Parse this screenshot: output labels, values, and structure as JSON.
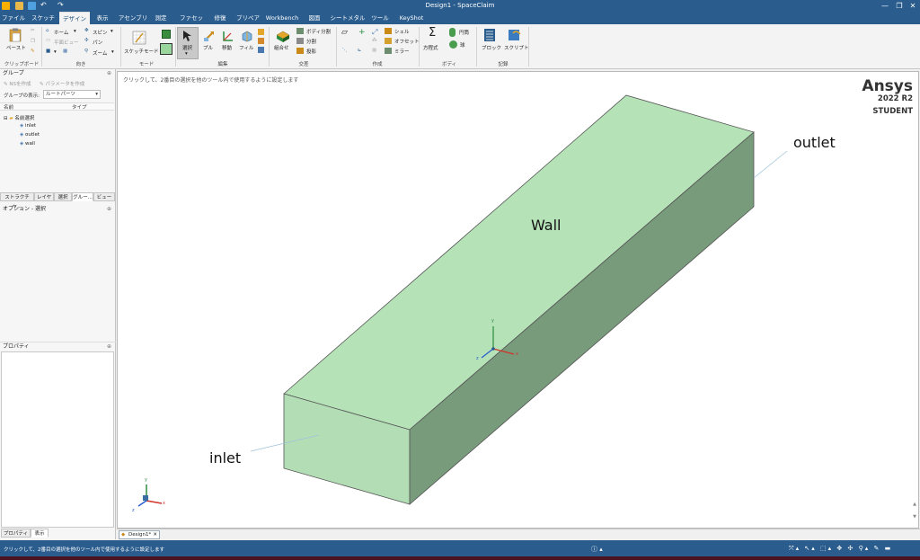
{
  "window": {
    "title": "Design1 - SpaceClaim",
    "controls": {
      "minimize": "—",
      "restore": "❐",
      "close": "✕"
    }
  },
  "tabs": [
    {
      "label": "ファイル"
    },
    {
      "label": "スケッチ"
    },
    {
      "label": "デザイン"
    },
    {
      "label": "表示"
    },
    {
      "label": "アセンブリ"
    },
    {
      "label": "測定"
    },
    {
      "label": "ファセット"
    },
    {
      "label": "修復"
    },
    {
      "label": "プリペア"
    },
    {
      "label": "Workbench"
    },
    {
      "label": "図面"
    },
    {
      "label": "シートメタル"
    },
    {
      "label": "ツール"
    },
    {
      "label": "KeyShot"
    }
  ],
  "active_tab": "デザイン",
  "ribbon": {
    "clipboard": {
      "paste": "ペースト",
      "group": "クリップボード"
    },
    "orient": {
      "home": "ホーム",
      "plane_view": "平面ビュー",
      "spin": "スピン",
      "pan": "パン",
      "zoom": "ズーム",
      "group": "向き"
    },
    "mode": {
      "sketch_mode": "スケッチモード",
      "group": "モード"
    },
    "edit": {
      "select": "選択",
      "pull": "プル",
      "move": "移動",
      "fill": "フィル",
      "group": "編集"
    },
    "intersect": {
      "combine": "組合せ",
      "split_body": "ボディ分割",
      "split": "分割",
      "project": "投影",
      "group": "交差"
    },
    "create": {
      "shell": "シェル",
      "offset": "オフセット",
      "mirror": "ミラー",
      "group": "作成"
    },
    "body": {
      "equation": "方程式",
      "cylinder": "円筒",
      "sphere": "球",
      "group": "ボディ"
    },
    "record": {
      "block": "ブロック",
      "script": "スクリプト",
      "group": "記録"
    }
  },
  "groups_panel": {
    "title": "グループ",
    "create_ns": "NSを作成",
    "create_param": "パラメータを作成",
    "display_label": "グループの表示:",
    "display_value": "ルートパーツ",
    "col_name": "名前",
    "col_type": "タイプ",
    "root": "名前選択",
    "items": [
      "inlet",
      "outlet",
      "wall"
    ]
  },
  "mid_tabs": [
    "ストラクチャ...",
    "レイヤ",
    "選択",
    "グルー...",
    "ビュー"
  ],
  "options_panel": {
    "title": "オプション - 選択"
  },
  "properties_panel": {
    "title": "プロパティ"
  },
  "bottom_tabs": [
    "プロパティ",
    "表示"
  ],
  "viewport": {
    "hint": "クリックして、2番目の選択を他のツール内で使用するように設定します",
    "brand": "Ansys",
    "version": "2022 R2",
    "edition": "STUDENT",
    "labels": {
      "wall": "Wall",
      "inlet": "inlet",
      "outlet": "outlet"
    },
    "axes": {
      "x": "x",
      "y": "y",
      "z": "z"
    }
  },
  "document_tab": "Design1*",
  "status": {
    "message": "クリックして、2番目の選択を他のツール内で使用するように設定します"
  },
  "colors": {
    "titlebar": "#2a5d8e",
    "box_top": "#b6e2b8",
    "box_front": "#b3ddb4",
    "box_side": "#789b7b"
  }
}
